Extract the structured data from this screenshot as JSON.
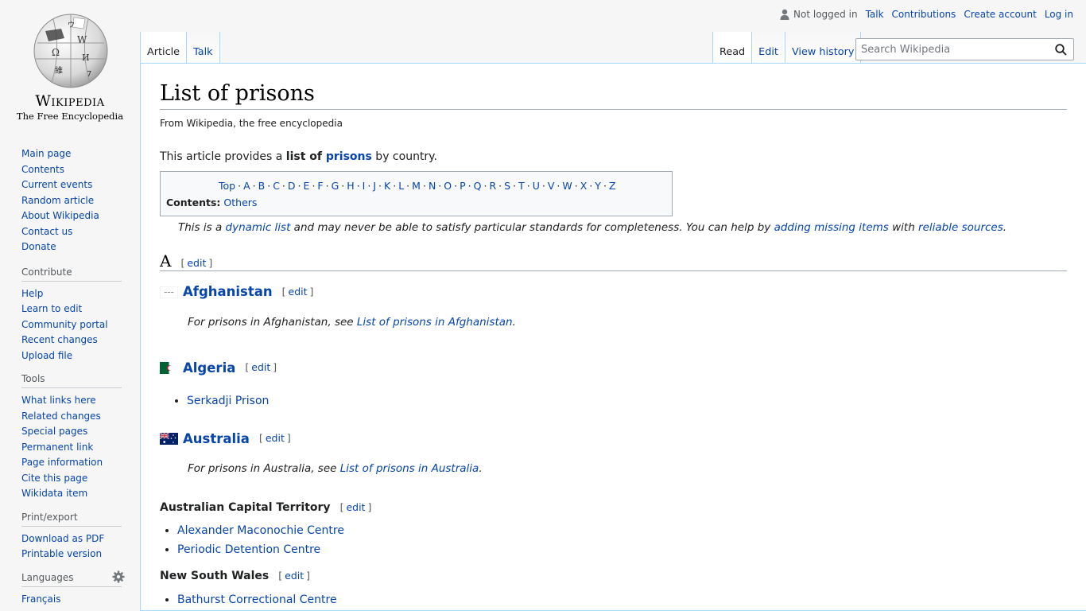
{
  "logo": {
    "wordmark": "Wikipedia",
    "tagline": "The Free Encyclopedia"
  },
  "personal": {
    "not_logged_in": "Not logged in",
    "talk": "Talk",
    "contributions": "Contributions",
    "create_account": "Create account",
    "log_in": "Log in"
  },
  "tabs": {
    "left": [
      "Article",
      "Talk"
    ],
    "right": [
      "Read",
      "Edit",
      "View history"
    ]
  },
  "search": {
    "placeholder": "Search Wikipedia"
  },
  "sidebar": {
    "navigation": [
      "Main page",
      "Contents",
      "Current events",
      "Random article",
      "About Wikipedia",
      "Contact us",
      "Donate"
    ],
    "contribute": {
      "heading": "Contribute",
      "items": [
        "Help",
        "Learn to edit",
        "Community portal",
        "Recent changes",
        "Upload file"
      ]
    },
    "tools": {
      "heading": "Tools",
      "items": [
        "What links here",
        "Related changes",
        "Special pages",
        "Permanent link",
        "Page information",
        "Cite this page",
        "Wikidata item"
      ]
    },
    "print": {
      "heading": "Print/export",
      "items": [
        "Download as PDF",
        "Printable version"
      ]
    },
    "languages": {
      "heading": "Languages",
      "items": [
        "Français"
      ]
    }
  },
  "article": {
    "title": "List of prisons",
    "site_sub": "From Wikipedia, the free encyclopedia",
    "intro": {
      "pre": "This article provides a ",
      "bold": "list of ",
      "link": "prisons",
      "post": " by country."
    },
    "toc": {
      "letters": [
        "Top",
        "A",
        "B",
        "C",
        "D",
        "E",
        "F",
        "G",
        "H",
        "I",
        "J",
        "K",
        "L",
        "M",
        "N",
        "O",
        "P",
        "Q",
        "R",
        "S",
        "T",
        "U",
        "V",
        "W",
        "X",
        "Y",
        "Z"
      ],
      "label": "Contents:",
      "others": "Others"
    },
    "hatnote": {
      "p1": "This is a ",
      "link1": "dynamic list",
      "p2": " and may never be able to satisfy particular standards for completeness. You can help by ",
      "link2": "adding missing items",
      "p3": " with ",
      "link3": "reliable sources",
      "p4": "."
    },
    "edit_open": "[",
    "edit_label": "edit",
    "edit_close": "]",
    "section_a": "A",
    "afghanistan": {
      "name": "Afghanistan",
      "note_pre": "For prisons in Afghanistan, see ",
      "note_link": "List of prisons in Afghanistan",
      "note_post": "."
    },
    "algeria": {
      "name": "Algeria",
      "prisons": [
        "Serkadji Prison"
      ]
    },
    "australia": {
      "name": "Australia",
      "note_pre": "For prisons in Australia, see ",
      "note_link": "List of prisons in Australia",
      "note_post": ".",
      "act": {
        "name": "Australian Capital Territory",
        "prisons": [
          "Alexander Maconochie Centre",
          "Periodic Detention Centre"
        ]
      },
      "nsw": {
        "name": "New South Wales",
        "prisons": [
          "Bathurst Correctional Centre"
        ]
      }
    }
  },
  "colors": {
    "link": "#0645ad",
    "border": "#a7d7f9",
    "sidebar_bg": "#f6f6f6"
  }
}
